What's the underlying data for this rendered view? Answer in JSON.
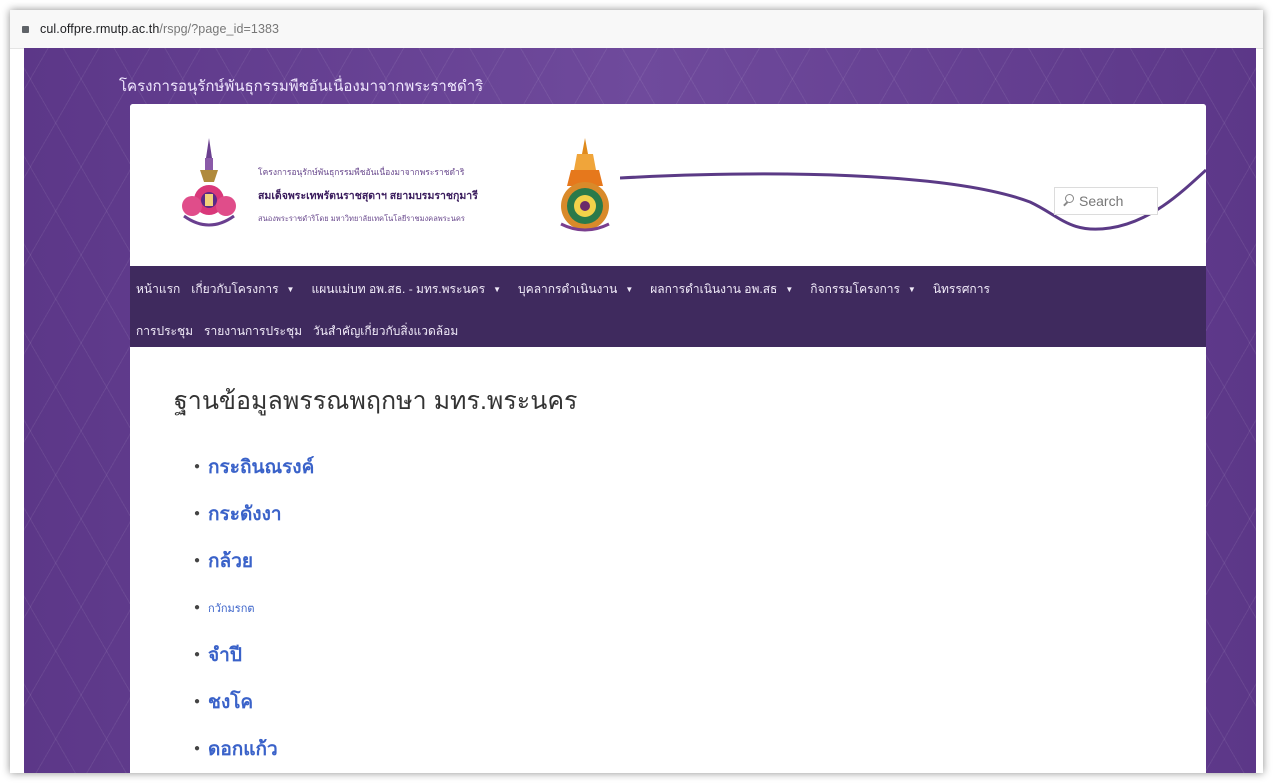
{
  "browser": {
    "url_domain": "cul.offpre.rmutp.ac.th",
    "url_path": "/rspg/?page_id=1383"
  },
  "site": {
    "tagline": "โครงการอนุรักษ์พันธุกรรมพืชอันเนื่องมาจากพระราชดำริ"
  },
  "header": {
    "logo_line1": "โครงการอนุรักษ์พันธุกรรมพืชอันเนื่องมาจากพระราชดำริ",
    "logo_line2": "สมเด็จพระเทพรัตนราชสุดาฯ สยามบรมราชกุมารี",
    "logo_line3": "สนองพระราชดำริโดย มหาวิทยาลัยเทคโนโลยีราชมงคลพระนคร",
    "search_placeholder": "Search"
  },
  "nav": {
    "row1": [
      {
        "label": "หน้าแรก",
        "dropdown": false
      },
      {
        "label": "เกี่ยวกับโครงการ",
        "dropdown": true
      },
      {
        "label": "แผนแม่บท อพ.สธ. - มทร.พระนคร",
        "dropdown": true
      },
      {
        "label": "บุคลากรดำเนินงาน",
        "dropdown": true
      },
      {
        "label": "ผลการดำเนินงาน อพ.สธ",
        "dropdown": true
      },
      {
        "label": "กิจกรรมโครงการ",
        "dropdown": true
      },
      {
        "label": "นิทรรศการ",
        "dropdown": false
      }
    ],
    "row2": [
      {
        "label": "การประชุม",
        "dropdown": false
      },
      {
        "label": "รายงานการประชุม",
        "dropdown": false
      },
      {
        "label": "วันสำคัญเกี่ยวกับสิ่งแวดล้อม",
        "dropdown": false
      }
    ]
  },
  "main": {
    "title": "ฐานข้อมูลพรรณพฤกษา มทร.พระนคร",
    "items": [
      "กระถินณรงค์",
      "กระดังงา",
      "กล้วย",
      "กวักมรกต",
      "จำปี",
      "ชงโค",
      "ดอกแก้ว"
    ]
  },
  "colors": {
    "nav_bg": "#3f2a5e",
    "stage_bg": "#6a4596",
    "link": "#3a62c9"
  }
}
